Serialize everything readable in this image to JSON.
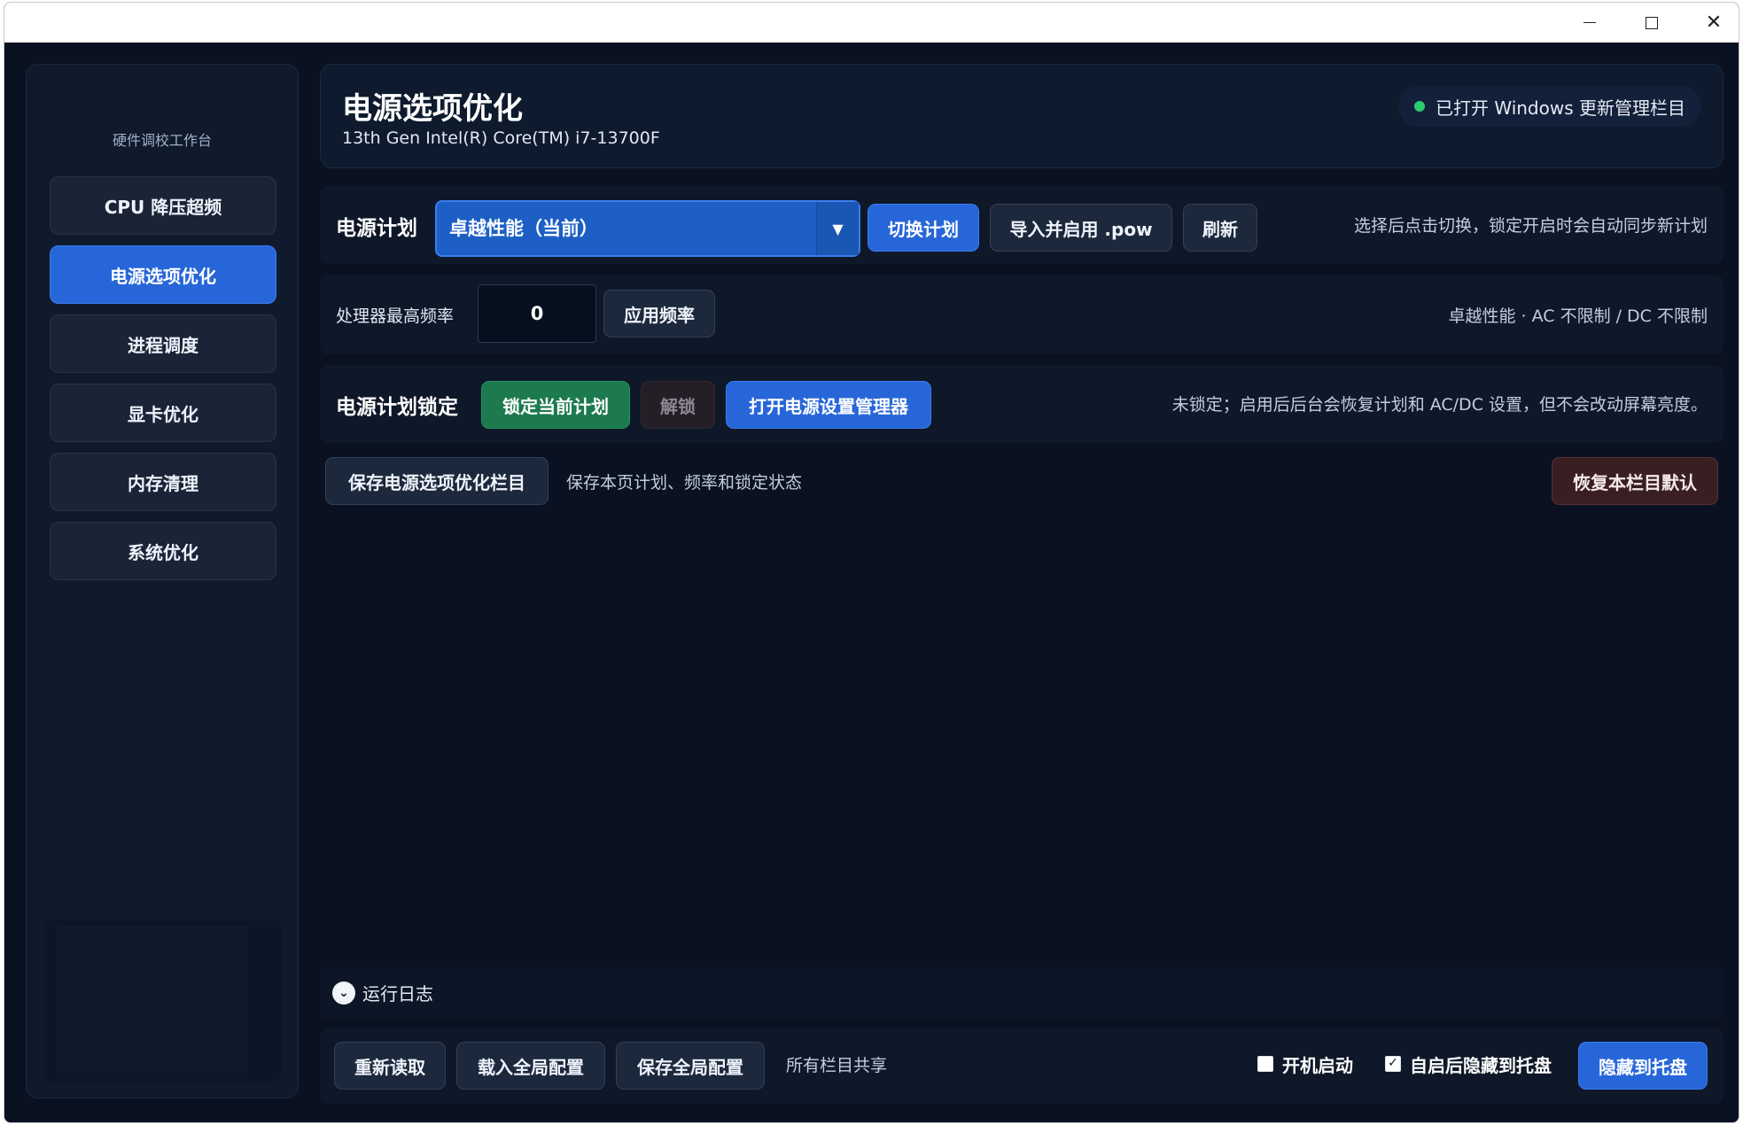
{
  "window": {
    "controls": {
      "minimize": "minimize",
      "maximize": "maximize",
      "close": "✕"
    }
  },
  "sidebar": {
    "title": "硬件调校工作台",
    "items": [
      {
        "label": "CPU 降压超频",
        "active": false
      },
      {
        "label": "电源选项优化",
        "active": true
      },
      {
        "label": "进程调度",
        "active": false
      },
      {
        "label": "显卡优化",
        "active": false
      },
      {
        "label": "内存清理",
        "active": false
      },
      {
        "label": "系统优化",
        "active": false
      }
    ]
  },
  "header": {
    "title": "电源选项优化",
    "subtitle": "13th Gen Intel(R) Core(TM) i7-13700F",
    "status": "已打开 Windows 更新管理栏目",
    "status_color": "#2ecc71"
  },
  "power_plan": {
    "label": "电源计划",
    "selected": "卓越性能（当前）",
    "switch_label": "切换计划",
    "import_label": "导入并启用 .pow",
    "refresh_label": "刷新",
    "hint": "选择后点击切换，锁定开启时会自动同步新计划"
  },
  "frequency": {
    "label": "处理器最高频率",
    "value": "0",
    "apply_label": "应用频率",
    "hint": "卓越性能 · AC 不限制 / DC 不限制"
  },
  "lock": {
    "label": "电源计划锁定",
    "lock_label": "锁定当前计划",
    "unlock_label": "解锁",
    "open_manager_label": "打开电源设置管理器",
    "hint": "未锁定；启用后后台会恢复计划和 AC/DC 设置，但不会改动屏幕亮度。"
  },
  "section": {
    "save_label": "保存电源选项优化栏目",
    "save_hint": "保存本页计划、频率和锁定状态",
    "restore_label": "恢复本栏目默认"
  },
  "log": {
    "label": "运行日志"
  },
  "footer": {
    "reload_label": "重新读取",
    "load_global_label": "载入全局配置",
    "save_global_label": "保存全局配置",
    "shared_hint": "所有栏目共享",
    "autostart_label": "开机启动",
    "autostart_checked": false,
    "hide_on_start_label": "自启后隐藏到托盘",
    "hide_on_start_checked": true,
    "hide_tray_label": "隐藏到托盘"
  },
  "colors": {
    "accent": "#2766d8",
    "success": "#1c7a4e",
    "danger": "#3a1f22",
    "background": "#0a1120"
  }
}
